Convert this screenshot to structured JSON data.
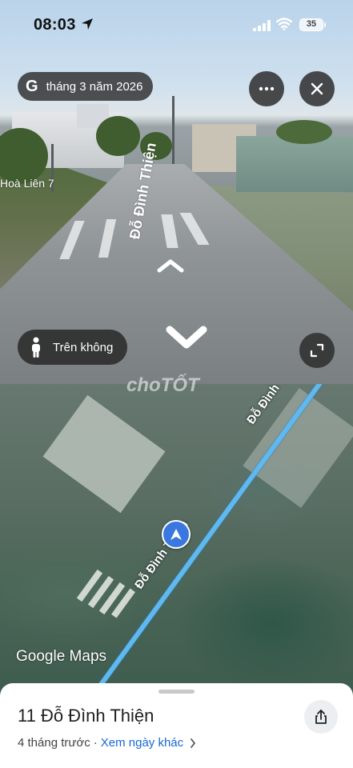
{
  "status_bar": {
    "time": "08:03",
    "battery": "35"
  },
  "street_view": {
    "date_chip": "tháng 3 năm 2026",
    "google_logo": "G",
    "road_label": "Đỗ Đình Thiện",
    "side_label": "Hoà Liên 7",
    "aerial_button_label": "Trên không",
    "icons": {
      "more": "more-icon",
      "close": "close-icon",
      "expand": "expand-icon",
      "person": "person-icon",
      "nav_up": "chevron-up-icon",
      "nav_down": "chevron-down-icon"
    }
  },
  "map": {
    "road_label_1": "Đỗ Đình Thiệ",
    "road_label_2": "Đỗ Đình Thiện",
    "watermark": "Google Maps",
    "overlay_watermark": "choTỐT",
    "road_color": "#5fb8ef",
    "pin_color": "#3a78e0"
  },
  "sheet": {
    "title": "11 Đỗ Đình Thiện",
    "age": "4 tháng trước",
    "separator": "·",
    "other_dates_link": "Xem ngày khác",
    "link_color": "#1967d2",
    "share_icon": "share-icon"
  }
}
